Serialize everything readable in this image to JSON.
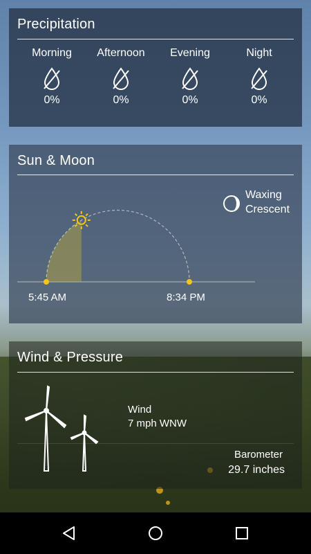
{
  "precipitation": {
    "title": "Precipitation",
    "periods": [
      {
        "label": "Morning",
        "value": "0%"
      },
      {
        "label": "Afternoon",
        "value": "0%"
      },
      {
        "label": "Evening",
        "value": "0%"
      },
      {
        "label": "Night",
        "value": "0%"
      }
    ]
  },
  "sun_moon": {
    "title": "Sun & Moon",
    "moon_phase_line1": "Waxing",
    "moon_phase_line2": "Crescent",
    "sunrise": "5:45 AM",
    "sunset": "8:34 PM",
    "day_progress": 0.33
  },
  "wind_pressure": {
    "title": "Wind & Pressure",
    "wind_label": "Wind",
    "wind_value": "7 mph WNW",
    "barometer_label": "Barometer",
    "barometer_value": "29.7 inches"
  },
  "colors": {
    "accent_sun": "#f5c518"
  },
  "navbar": {
    "icons": [
      "back-icon",
      "home-icon",
      "recents-icon"
    ]
  }
}
